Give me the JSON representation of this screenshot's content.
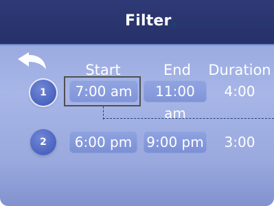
{
  "header": {
    "title": "Filter"
  },
  "columns": {
    "start": "Start",
    "end": "End",
    "duration": "Duration"
  },
  "rows": [
    {
      "index": "1",
      "start": "7:00 am",
      "end": "11:00 am",
      "duration": "4:00"
    },
    {
      "index": "2",
      "start": "6:00 pm",
      "end": "9:00 pm",
      "duration": "3:00"
    }
  ],
  "icons": {
    "back": "back-arrow-icon",
    "callout": "callout-dot-icon"
  },
  "colors": {
    "header": "#2f3a76",
    "background": "#a7b6e7",
    "pill": "#7f96df",
    "selected_outline": "#4f4f4f",
    "text": "#ffffff"
  }
}
